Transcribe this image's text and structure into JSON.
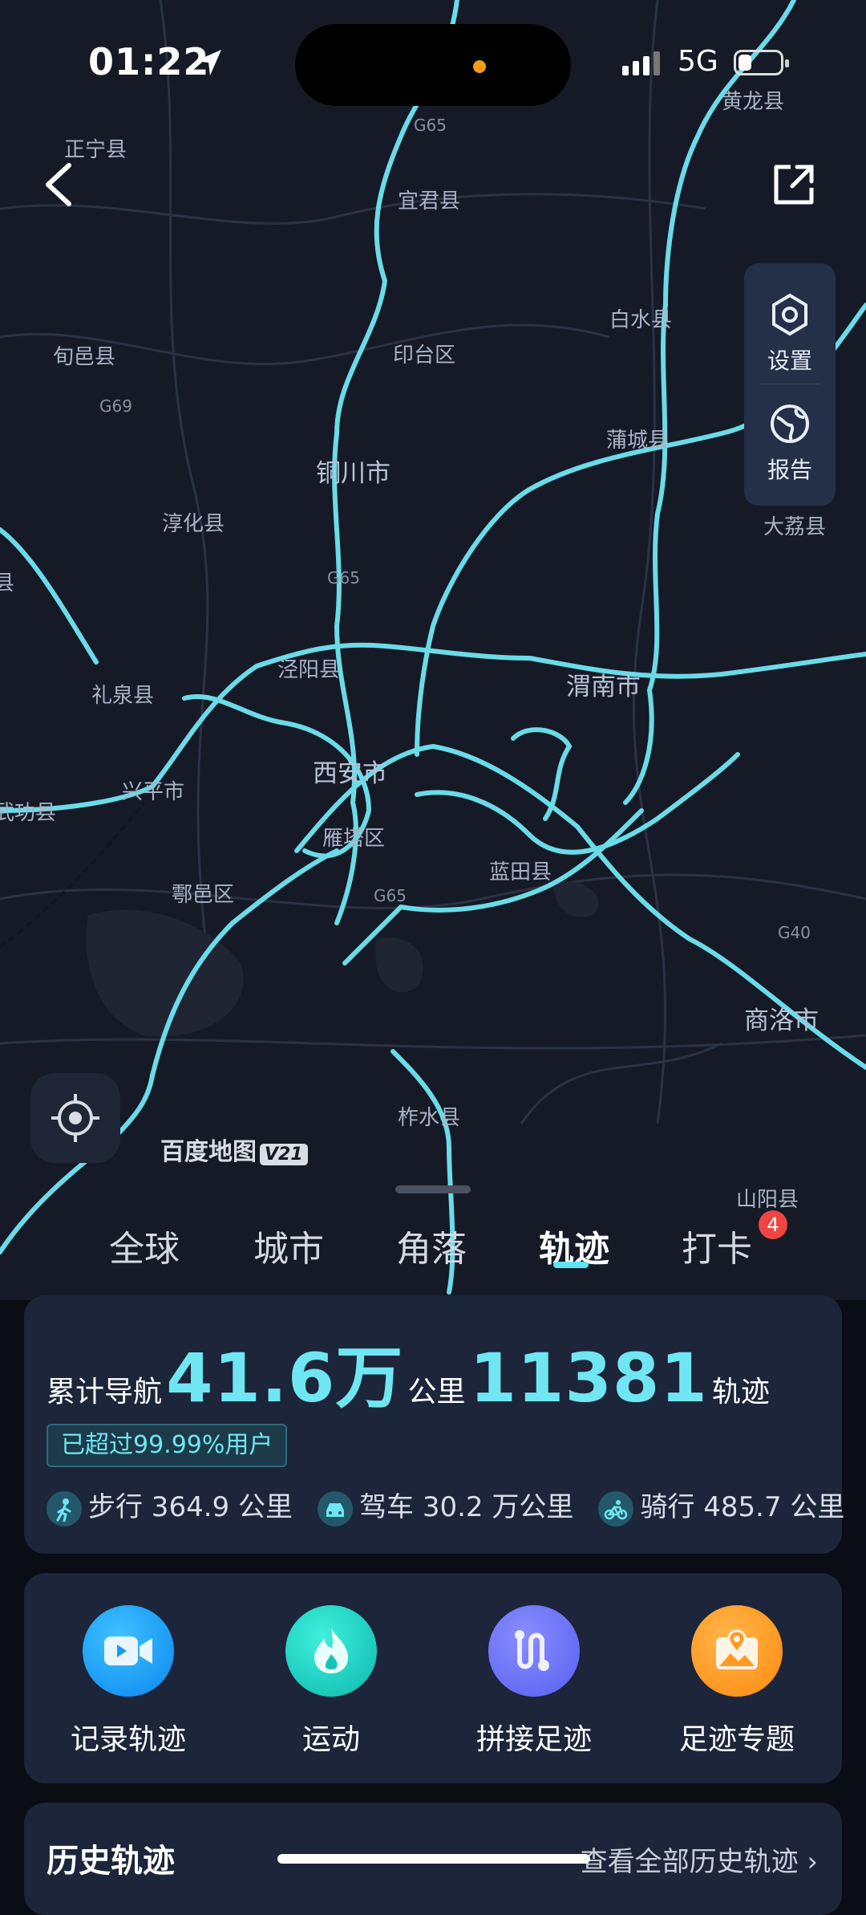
{
  "status_bar": {
    "time": "01:22",
    "network": "5G"
  },
  "map": {
    "places": [
      "黄龙县",
      "正宁县",
      "宜君县",
      "白水县",
      "旬邑县",
      "印台区",
      "蒲城县",
      "铜川市",
      "淳化县",
      "大荔县",
      "泾阳县",
      "礼泉县",
      "渭南市",
      "兴平市",
      "西安市",
      "武功县",
      "雁塔区",
      "蓝田县",
      "鄠邑区",
      "商洛市",
      "柞水县",
      "山阳县",
      "县"
    ],
    "roads": [
      "G65",
      "G69",
      "G65",
      "G65",
      "G40"
    ],
    "logo": "百度地图",
    "logo_version": "V21"
  },
  "side_panel": {
    "settings": "设置",
    "report": "报告"
  },
  "tabs": [
    {
      "label": "全球",
      "active": false
    },
    {
      "label": "城市",
      "active": false
    },
    {
      "label": "角落",
      "active": false
    },
    {
      "label": "轨迹",
      "active": true
    },
    {
      "label": "打卡",
      "active": false
    }
  ],
  "checkin_badge": "4",
  "summary": {
    "prefix": "累计导航",
    "distance": "41.6万",
    "distance_unit": "公里",
    "tracks": "11381",
    "tracks_unit": "轨迹",
    "rank": "已超过99.99%用户",
    "walk": "步行 364.9 公里",
    "drive": "驾车 30.2 万公里",
    "ride": "骑行 485.7 公里"
  },
  "functions": {
    "record": "记录轨迹",
    "sport": "运动",
    "stitch": "拼接足迹",
    "topic": "足迹专题"
  },
  "history": {
    "title": "历史轨迹",
    "link": "查看全部历史轨迹"
  },
  "colors": {
    "accent": "#6fe6f2",
    "route": "#6fe6f2",
    "badge": "#ef4542"
  }
}
